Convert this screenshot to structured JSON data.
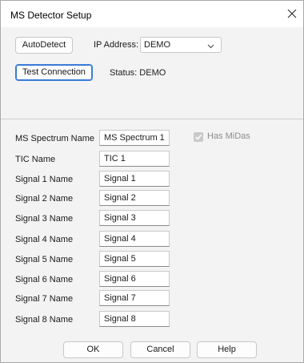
{
  "window": {
    "title": "MS Detector Setup",
    "close_icon": "close-icon"
  },
  "connection": {
    "autodetect_label": "AutoDetect",
    "ip_label": "IP Address:",
    "ip_value": "DEMO",
    "test_label": "Test Connection",
    "status_text": "Status: DEMO"
  },
  "names": {
    "spectrum_label": "MS Spectrum Name",
    "spectrum_value": "MS Spectrum 1",
    "has_midas_label": "Has MiDas",
    "has_midas_checked": true,
    "tic_label": "TIC Name",
    "tic_value": "TIC 1",
    "signals": [
      {
        "label": "Signal 1 Name",
        "value": "Signal 1"
      },
      {
        "label": "Signal 2 Name",
        "value": "Signal 2"
      },
      {
        "label": "Signal 3 Name",
        "value": "Signal 3"
      },
      {
        "label": "Signal 4 Name",
        "value": "Signal 4"
      },
      {
        "label": "Signal 5 Name",
        "value": "Signal 5"
      },
      {
        "label": "Signal 6 Name",
        "value": "Signal 6"
      },
      {
        "label": "Signal 7 Name",
        "value": "Signal 7"
      },
      {
        "label": "Signal 8 Name",
        "value": "Signal 8"
      }
    ]
  },
  "buttons": {
    "ok": "OK",
    "cancel": "Cancel",
    "help": "Help"
  }
}
